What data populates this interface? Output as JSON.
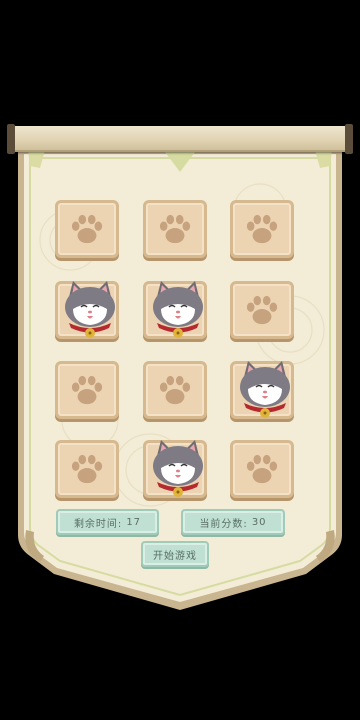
{
  "game": {
    "board": {
      "rows": 4,
      "cols": 3,
      "tiles": [
        {
          "row": 0,
          "col": 0,
          "content": "paw"
        },
        {
          "row": 0,
          "col": 1,
          "content": "paw"
        },
        {
          "row": 0,
          "col": 2,
          "content": "paw"
        },
        {
          "row": 1,
          "col": 0,
          "content": "cat"
        },
        {
          "row": 1,
          "col": 1,
          "content": "cat"
        },
        {
          "row": 1,
          "col": 2,
          "content": "paw"
        },
        {
          "row": 2,
          "col": 0,
          "content": "paw"
        },
        {
          "row": 2,
          "col": 1,
          "content": "paw"
        },
        {
          "row": 2,
          "col": 2,
          "content": "cat"
        },
        {
          "row": 3,
          "col": 0,
          "content": "paw"
        },
        {
          "row": 3,
          "col": 1,
          "content": "cat"
        },
        {
          "row": 3,
          "col": 2,
          "content": "paw"
        }
      ]
    },
    "status": {
      "time_label": "剩余时间:",
      "time_value": "17",
      "score_label": "当前分数:",
      "score_value": "30"
    },
    "start_button_label": "开始游戏"
  },
  "icons": {
    "tile_icon": "paw-icon",
    "mole_icon": "cat-icon"
  },
  "colors": {
    "background": "#000000",
    "banner": "#f3ecd6",
    "banner_border": "#c9b58f",
    "tile": "#ecd4b2",
    "paw": "#c7a27e",
    "pill": "#bfe0d2"
  }
}
